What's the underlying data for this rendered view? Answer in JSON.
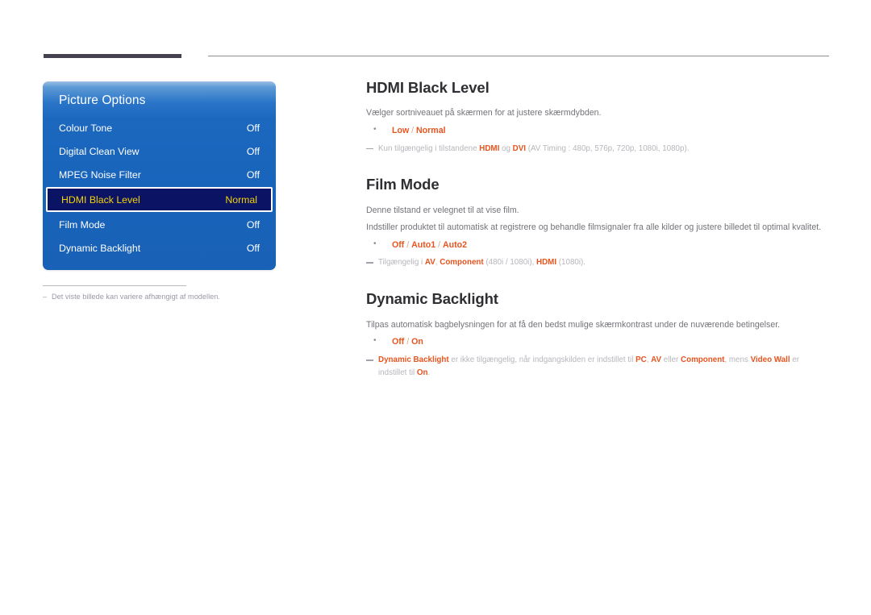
{
  "osd": {
    "title": "Picture Options",
    "rows": [
      {
        "label": "Colour Tone",
        "value": "Off",
        "selected": false
      },
      {
        "label": "Digital Clean View",
        "value": "Off",
        "selected": false
      },
      {
        "label": "MPEG Noise Filter",
        "value": "Off",
        "selected": false
      },
      {
        "label": "HDMI Black Level",
        "value": "Normal",
        "selected": true
      },
      {
        "label": "Film Mode",
        "value": "Off",
        "selected": false
      },
      {
        "label": "Dynamic Backlight",
        "value": "Off",
        "selected": false
      }
    ],
    "note_dash": "–",
    "note": "Det viste billede kan variere afhængigt af modellen."
  },
  "sections": [
    {
      "title": "HDMI Black Level",
      "paragraphs": [
        "Vælger sortniveauet på skærmen for at justere skærmdybden."
      ],
      "options": [
        {
          "a": "Low",
          "sep1": " / ",
          "b": "Normal"
        }
      ],
      "note": {
        "p1": "Kun tilgængelig i tilstandene ",
        "b1": "HDMI",
        "p2": " og ",
        "b2": "DVI",
        "p3": " (AV Timing : 480p, 576p, 720p, 1080i, 1080p)."
      }
    },
    {
      "title": "Film Mode",
      "paragraphs": [
        "Denne tilstand er velegnet til at vise film.",
        "Indstiller produktet til automatisk at registrere og behandle filmsignaler fra alle kilder og justere billedet til optimal kvalitet."
      ],
      "options": [
        {
          "a": "Off",
          "sep1": " / ",
          "b": "Auto1",
          "sep2": " / ",
          "c": "Auto2"
        }
      ],
      "note": {
        "p1": "Tilgængelig i ",
        "b1": "AV",
        "p2": ", ",
        "b2": "Component",
        "p3": " (480i / 1080i), ",
        "b3": "HDMI",
        "p4": " (1080i)."
      }
    },
    {
      "title": "Dynamic Backlight",
      "paragraphs": [
        "Tilpas automatisk bagbelysningen for at få den bedst mulige skærmkontrast under de nuværende betingelser."
      ],
      "options": [
        {
          "a": "Off",
          "sep1": " / ",
          "b": "On"
        }
      ],
      "note": {
        "b1": "Dynamic Backlight",
        "p1": " er ikke tilgængelig, når indgangskilden er indstillet til ",
        "b2": "PC",
        "p2": ", ",
        "b3": "AV",
        "p3": " eller ",
        "b4": "Component",
        "p4": ", mens ",
        "b5": "Video Wall",
        "p5": " er indstillet til ",
        "b6": "On",
        "p6": "."
      }
    }
  ],
  "colors": {
    "accent": "#e8541f",
    "osd_blue": "#1863ba",
    "osd_selected_bg": "#0b1464",
    "osd_selected_text": "#f2d10a",
    "heading": "#2f2f33",
    "body_text": "#73737a",
    "rule_dark": "#46424f"
  }
}
